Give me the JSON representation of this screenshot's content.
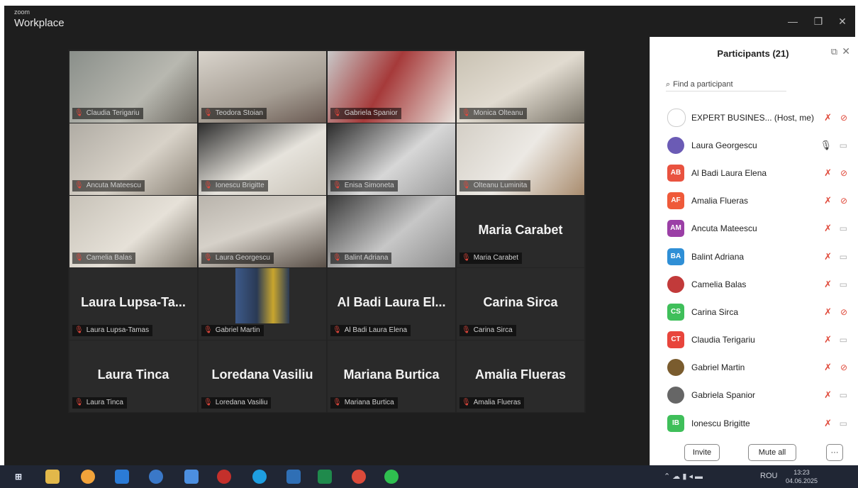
{
  "window": {
    "brand_small": "zoom",
    "brand_main": "Workplace"
  },
  "gallery": {
    "tiles": [
      {
        "label": "Claudia Terigariu",
        "video": true
      },
      {
        "label": "Teodora Stoian",
        "video": true
      },
      {
        "label": "Gabriela Spanior",
        "video": true
      },
      {
        "label": "Monica Olteanu",
        "video": true
      },
      {
        "label": "Ancuta Mateescu",
        "video": true
      },
      {
        "label": "Ionescu Brigitte",
        "video": true
      },
      {
        "label": "Enisa Simoneta",
        "video": true
      },
      {
        "label": "Olteanu Luminita",
        "video": true
      },
      {
        "label": "Camelia Balas",
        "video": true
      },
      {
        "label": "Laura Georgescu",
        "video": true,
        "active": true
      },
      {
        "label": "Balint Adriana",
        "video": true
      },
      {
        "label": "Maria Carabet",
        "big": "Maria Carabet"
      },
      {
        "label": "Laura Lupsa-Tamas",
        "big": "Laura  Lupsa-Ta..."
      },
      {
        "label": "Gabriel Martin",
        "photo": true
      },
      {
        "label": "Al Badi Laura Elena",
        "big": "Al Badi Laura El..."
      },
      {
        "label": "Carina Sirca",
        "big": "Carina Sirca"
      },
      {
        "label": "Laura Tinca",
        "big": "Laura Tinca"
      },
      {
        "label": "Loredana Vasiliu",
        "big": "Loredana Vasiliu"
      },
      {
        "label": "Mariana Burtica",
        "big": "Mariana Burtica"
      },
      {
        "label": "Amalia Flueras",
        "big": "Amalia Flueras"
      }
    ]
  },
  "participants": {
    "title": "Participants (21)",
    "search_placeholder": "Find a participant",
    "list": [
      {
        "name": "EXPERT BUSINES... (Host, me)",
        "initials": "",
        "color": "#ffffff",
        "mic": "off",
        "cam": "off"
      },
      {
        "name": "Laura Georgescu",
        "initials": "",
        "color": "#6b5bb5",
        "mic": "on",
        "cam": "on"
      },
      {
        "name": "Al Badi Laura Elena",
        "initials": "AB",
        "color": "#e9523f",
        "mic": "off",
        "cam": "off"
      },
      {
        "name": "Amalia Flueras",
        "initials": "AF",
        "color": "#ef5a3a",
        "mic": "off",
        "cam": "off"
      },
      {
        "name": "Ancuta Mateescu",
        "initials": "AM",
        "color": "#9b3fa6",
        "mic": "off",
        "cam": "on"
      },
      {
        "name": "Balint Adriana",
        "initials": "BA",
        "color": "#2f8fd6",
        "mic": "off",
        "cam": "on"
      },
      {
        "name": "Camelia Balas",
        "initials": "",
        "color": "#c23a3a",
        "mic": "off",
        "cam": "on"
      },
      {
        "name": "Carina Sirca",
        "initials": "CS",
        "color": "#3fbf5a",
        "mic": "off",
        "cam": "off"
      },
      {
        "name": "Claudia Terigariu",
        "initials": "CT",
        "color": "#e8453c",
        "mic": "off",
        "cam": "on"
      },
      {
        "name": "Gabriel Martin",
        "initials": "",
        "color": "#7a5c2e",
        "mic": "off",
        "cam": "off"
      },
      {
        "name": "Gabriela Spanior",
        "initials": "",
        "color": "#666666",
        "mic": "off",
        "cam": "on"
      },
      {
        "name": "Ionescu Brigitte",
        "initials": "IB",
        "color": "#3fbf5a",
        "mic": "off",
        "cam": "on"
      }
    ],
    "invite_label": "Invite",
    "mute_all_label": "Mute all",
    "more_label": "···"
  },
  "taskbar": {
    "lang": "ROU",
    "time": "13:23",
    "date": "04.06.2025"
  }
}
